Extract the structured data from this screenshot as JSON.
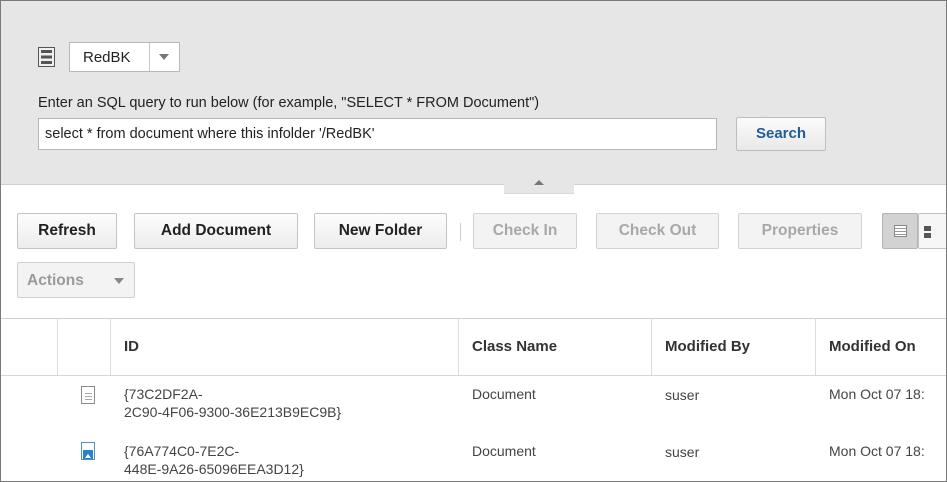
{
  "repository": {
    "name": "RedBK",
    "icon": "repository-icon"
  },
  "query": {
    "label": "Enter an SQL query to run below (for example, \"SELECT * FROM Document\")",
    "value": "select * from document where this infolder '/RedBK'",
    "search_label": "Search"
  },
  "toolbar": {
    "refresh_label": "Refresh",
    "add_document_label": "Add Document",
    "new_folder_label": "New Folder",
    "check_in_label": "Check In",
    "check_out_label": "Check Out",
    "properties_label": "Properties",
    "actions_label": "Actions",
    "list_view_icon": "list-view-icon",
    "thumbnail_view_icon": "thumbnail-view-icon"
  },
  "grid": {
    "columns": [
      "ID",
      "Class Name",
      "Modified By",
      "Modified On"
    ],
    "rows": [
      {
        "icon": "document-icon",
        "id_line1": "{73C2DF2A-",
        "id_line2": "2C90-4F06-9300-36E213B9EC9B}",
        "class_name": "Document",
        "modified_by": "suser",
        "modified_on": "Mon Oct 07 18:"
      },
      {
        "icon": "image-document-icon",
        "id_line1": "{76A774C0-7E2C-",
        "id_line2": "448E-9A26-65096EEA3D12}",
        "class_name": "Document",
        "modified_by": "suser",
        "modified_on": "Mon Oct 07 18:"
      }
    ]
  }
}
